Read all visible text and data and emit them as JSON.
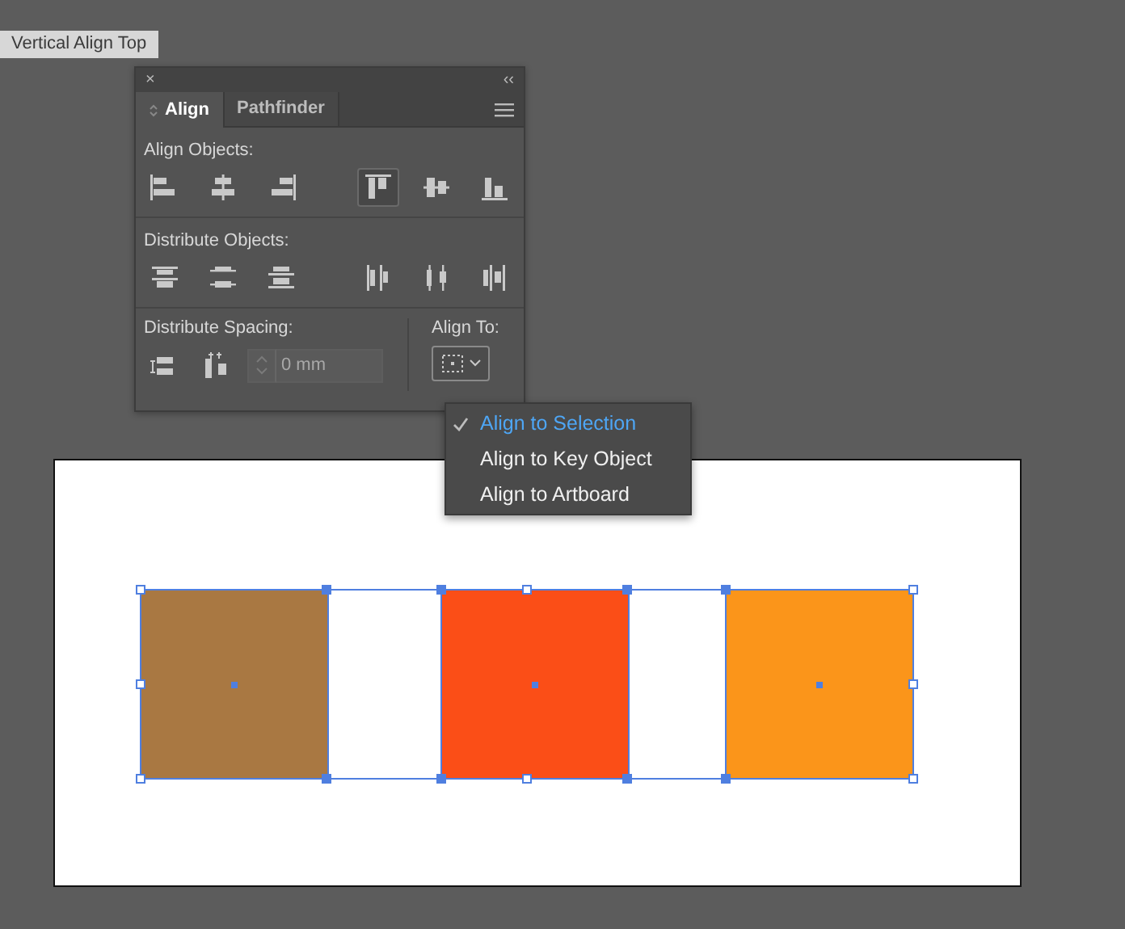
{
  "tooltip": {
    "text": "Vertical Align Top"
  },
  "panel": {
    "close": "×",
    "collapse": "‹‹",
    "tabs": [
      {
        "label": "Align",
        "selected": true
      },
      {
        "label": "Pathfinder",
        "selected": false
      }
    ],
    "align_objects": {
      "label": "Align Objects:",
      "buttons": [
        {
          "kind": "align-left",
          "selected": false
        },
        {
          "kind": "align-hcenter",
          "selected": false
        },
        {
          "kind": "align-right",
          "selected": false
        },
        {
          "kind": "align-top",
          "selected": true
        },
        {
          "kind": "align-vcenter",
          "selected": false
        },
        {
          "kind": "align-bottom",
          "selected": false
        }
      ]
    },
    "distribute_objects": {
      "label": "Distribute Objects:",
      "buttons": [
        {
          "kind": "dist-top",
          "selected": false
        },
        {
          "kind": "dist-vcenter",
          "selected": false
        },
        {
          "kind": "dist-bottom",
          "selected": false
        },
        {
          "kind": "dist-left",
          "selected": false
        },
        {
          "kind": "dist-hcenter",
          "selected": false
        },
        {
          "kind": "dist-right",
          "selected": false
        }
      ]
    },
    "distribute_spacing": {
      "label": "Distribute Spacing:",
      "buttons": [
        {
          "kind": "space-v",
          "selected": false
        },
        {
          "kind": "space-h",
          "selected": false
        }
      ],
      "field": {
        "value": "0 mm",
        "disabled": true
      }
    },
    "align_to": {
      "label": "Align To:",
      "expanded": true
    }
  },
  "menu": {
    "items": [
      {
        "label": "Align to Selection",
        "selected": true
      },
      {
        "label": "Align to Key Object",
        "selected": false
      },
      {
        "label": "Align to Artboard",
        "selected": false
      }
    ]
  },
  "artboard": {
    "shapes": [
      {
        "color": "#a97842"
      },
      {
        "color": "#fb4e17"
      },
      {
        "color": "#fb951a"
      }
    ],
    "selected": true
  }
}
